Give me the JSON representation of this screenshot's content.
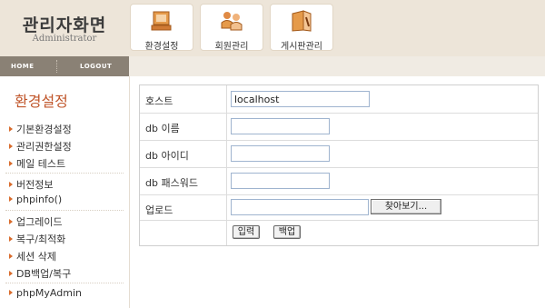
{
  "brand": {
    "title": "관리자화면",
    "subtitle": "Administrator"
  },
  "tabs": [
    {
      "label": "환경설정",
      "icon": "monitor-icon"
    },
    {
      "label": "회원관리",
      "icon": "members-icon"
    },
    {
      "label": "게시판관리",
      "icon": "board-icon"
    }
  ],
  "nav": {
    "home": "HOME",
    "logout": "LOGOUT"
  },
  "sidebar": {
    "title": "환경설정",
    "items": [
      "기본환경설정",
      "관리권한설정",
      "메일 테스트",
      "버전정보",
      "phpinfo()",
      "업그레이드",
      "복구/최적화",
      "세션 삭제",
      "DB백업/복구",
      "phpMyAdmin"
    ]
  },
  "form": {
    "host_label": "호스트",
    "host_value": "localhost",
    "dbname_label": "db 이름",
    "dbname_value": "",
    "dbid_label": "db 아이디",
    "dbid_value": "",
    "dbpw_label": "db 패스워드",
    "dbpw_value": "",
    "upload_label": "업로드",
    "upload_value": "",
    "browse_label": "찾아보기...",
    "submit_label": "입력",
    "backup_label": "백업"
  },
  "colors": {
    "header_bg": "#ede5d9",
    "nav_bg": "#8a8175",
    "accent": "#c0552a",
    "arrow": "#d96b2b"
  }
}
